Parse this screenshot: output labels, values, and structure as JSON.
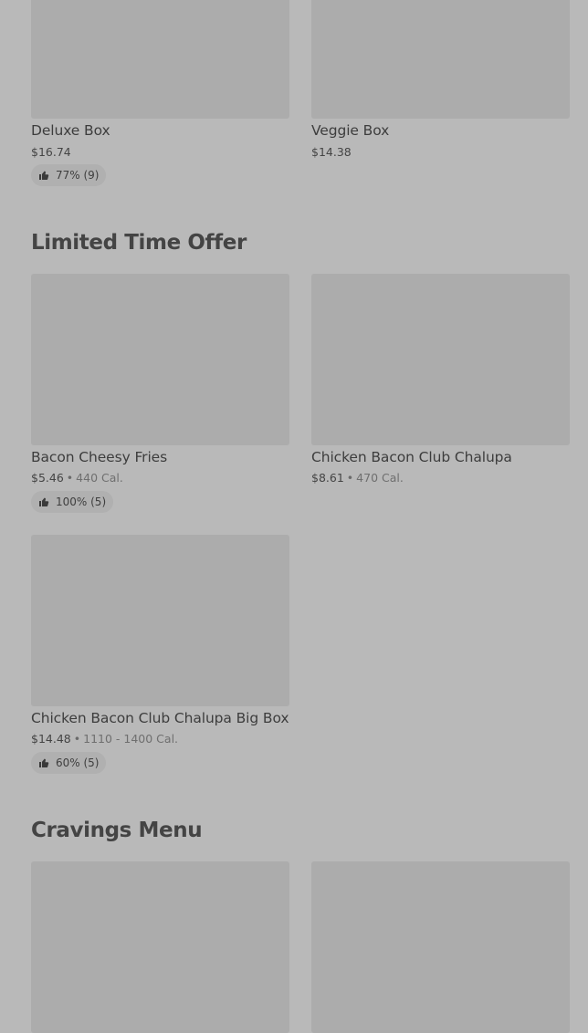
{
  "sections": [
    {
      "items": [
        {
          "name": "Deluxe Box",
          "price": "$16.74",
          "rating": "77% (9)"
        },
        {
          "name": "Veggie Box",
          "price": "$14.38"
        }
      ]
    },
    {
      "title": "Limited Time Offer",
      "items": [
        {
          "name": "Bacon Cheesy Fries",
          "price": "$5.46",
          "calories": "440 Cal.",
          "rating": "100% (5)"
        },
        {
          "name": "Chicken Bacon Club Chalupa",
          "price": "$8.61",
          "calories": "470 Cal."
        },
        {
          "name": "Chicken Bacon Club Chalupa Big Box",
          "price": "$14.48",
          "calories": "1110 - 1400 Cal.",
          "rating": "60% (5)"
        }
      ]
    },
    {
      "title": "Cravings Menu",
      "items": []
    }
  ],
  "separator": "•",
  "icons": {
    "rating": "thumbs-up-icon"
  },
  "colors": {
    "background": "#b9b9b9",
    "image_placeholder": "#acacac",
    "badge": "#b0b0b0"
  }
}
